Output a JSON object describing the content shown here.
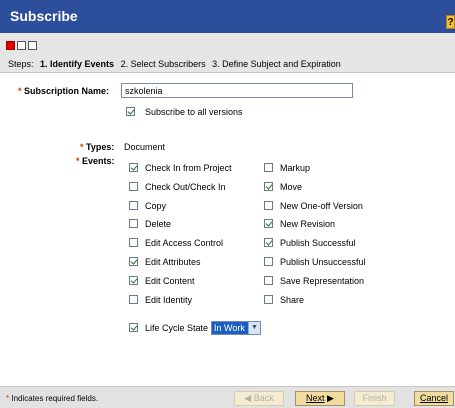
{
  "window": {
    "title": "Subscribe",
    "help_label": "?"
  },
  "wizard": {
    "steps_prefix": "Steps:",
    "steps": [
      {
        "label": "1. Identify Events",
        "current": true
      },
      {
        "label": "2. Select Subscribers",
        "current": false
      },
      {
        "label": "3. Define Subject and Expiration",
        "current": false
      }
    ],
    "indicator_colors": {
      "active": "#e00000",
      "inactive": "#ffffff"
    }
  },
  "form": {
    "required_mark": "*",
    "subscription_name_label": "Subscription Name:",
    "subscription_name_value": "szkolenia",
    "subscribe_all_versions_label": "Subscribe to all versions",
    "subscribe_all_versions_checked": true,
    "types_label": "Types:",
    "types_value": "Document",
    "events_label": "Events:",
    "events_left": [
      {
        "label": "Check In from Project",
        "checked": true
      },
      {
        "label": "Check Out/Check In",
        "checked": false
      },
      {
        "label": "Copy",
        "checked": false
      },
      {
        "label": "Delete",
        "checked": false
      },
      {
        "label": "Edit Access Control",
        "checked": false
      },
      {
        "label": "Edit Attributes",
        "checked": true
      },
      {
        "label": "Edit Content",
        "checked": true
      },
      {
        "label": "Edit Identity",
        "checked": false
      }
    ],
    "events_right": [
      {
        "label": "Markup",
        "checked": false
      },
      {
        "label": "Move",
        "checked": true
      },
      {
        "label": "New One-off Version",
        "checked": false
      },
      {
        "label": "New Revision",
        "checked": true
      },
      {
        "label": "Publish Successful",
        "checked": true
      },
      {
        "label": "Publish Unsuccessful",
        "checked": false
      },
      {
        "label": "Save Representation",
        "checked": false
      },
      {
        "label": "Share",
        "checked": false
      }
    ],
    "lifecycle_label": "Life Cycle State",
    "lifecycle_checked": true,
    "lifecycle_state_value": "In Work"
  },
  "footer": {
    "required_note": "Indicates required fields.",
    "back_label": "Back",
    "next_label": "Next",
    "finish_label": "Finish",
    "cancel_label": "Cancel"
  }
}
